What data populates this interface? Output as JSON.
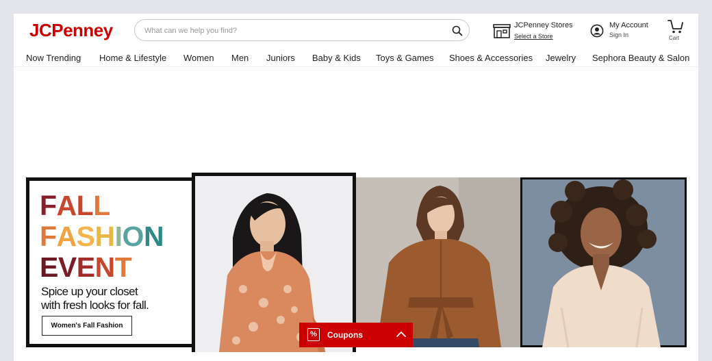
{
  "brand": {
    "logo": "JCPenney",
    "color": "#cc0000"
  },
  "search": {
    "placeholder": "What can we help you find?",
    "icon": "search-icon"
  },
  "header": {
    "stores": {
      "title": "JCPenney Stores",
      "link": "Select a Store",
      "icon": "store-icon"
    },
    "account": {
      "title": "My Account",
      "sub": "Sign In",
      "icon": "account-icon"
    },
    "cart": {
      "label": "Cart",
      "icon": "cart-icon"
    }
  },
  "nav": [
    "Now Trending",
    "Home & Lifestyle",
    "Women",
    "Men",
    "Juniors",
    "Baby & Kids",
    "Toys & Games",
    "Shoes & Accessories",
    "Jewelry",
    "Sephora Beauty & Salon"
  ],
  "hero": {
    "headline": [
      [
        {
          "t": "F",
          "c": "#8a1f2b"
        },
        {
          "t": "A",
          "c": "#c8452e"
        },
        {
          "t": "L",
          "c": "#c8452e"
        },
        {
          "t": "L",
          "c": "#e07a3c"
        }
      ],
      [
        {
          "t": "F",
          "c": "#e07a3c"
        },
        {
          "t": "A",
          "c": "#f0a342"
        },
        {
          "t": "S",
          "c": "#f4b54c"
        },
        {
          "t": "H",
          "c": "#e7b845"
        },
        {
          "t": "I",
          "c": "#8fb59a"
        },
        {
          "t": "O",
          "c": "#5aa3a0"
        },
        {
          "t": "N",
          "c": "#2e8a86"
        }
      ],
      [
        {
          "t": "E",
          "c": "#6b1822"
        },
        {
          "t": "V",
          "c": "#7c1c26"
        },
        {
          "t": "E",
          "c": "#a22b2c"
        },
        {
          "t": "N",
          "c": "#c8452e"
        },
        {
          "t": "T",
          "c": "#e07a3c"
        }
      ]
    ],
    "tagline": [
      "Spice up your closet",
      "with fresh looks for fall."
    ],
    "cta": "Women's Fall Fashion"
  },
  "coupons": {
    "label": "Coupons",
    "icon": "percent-icon",
    "symbol": "%"
  }
}
